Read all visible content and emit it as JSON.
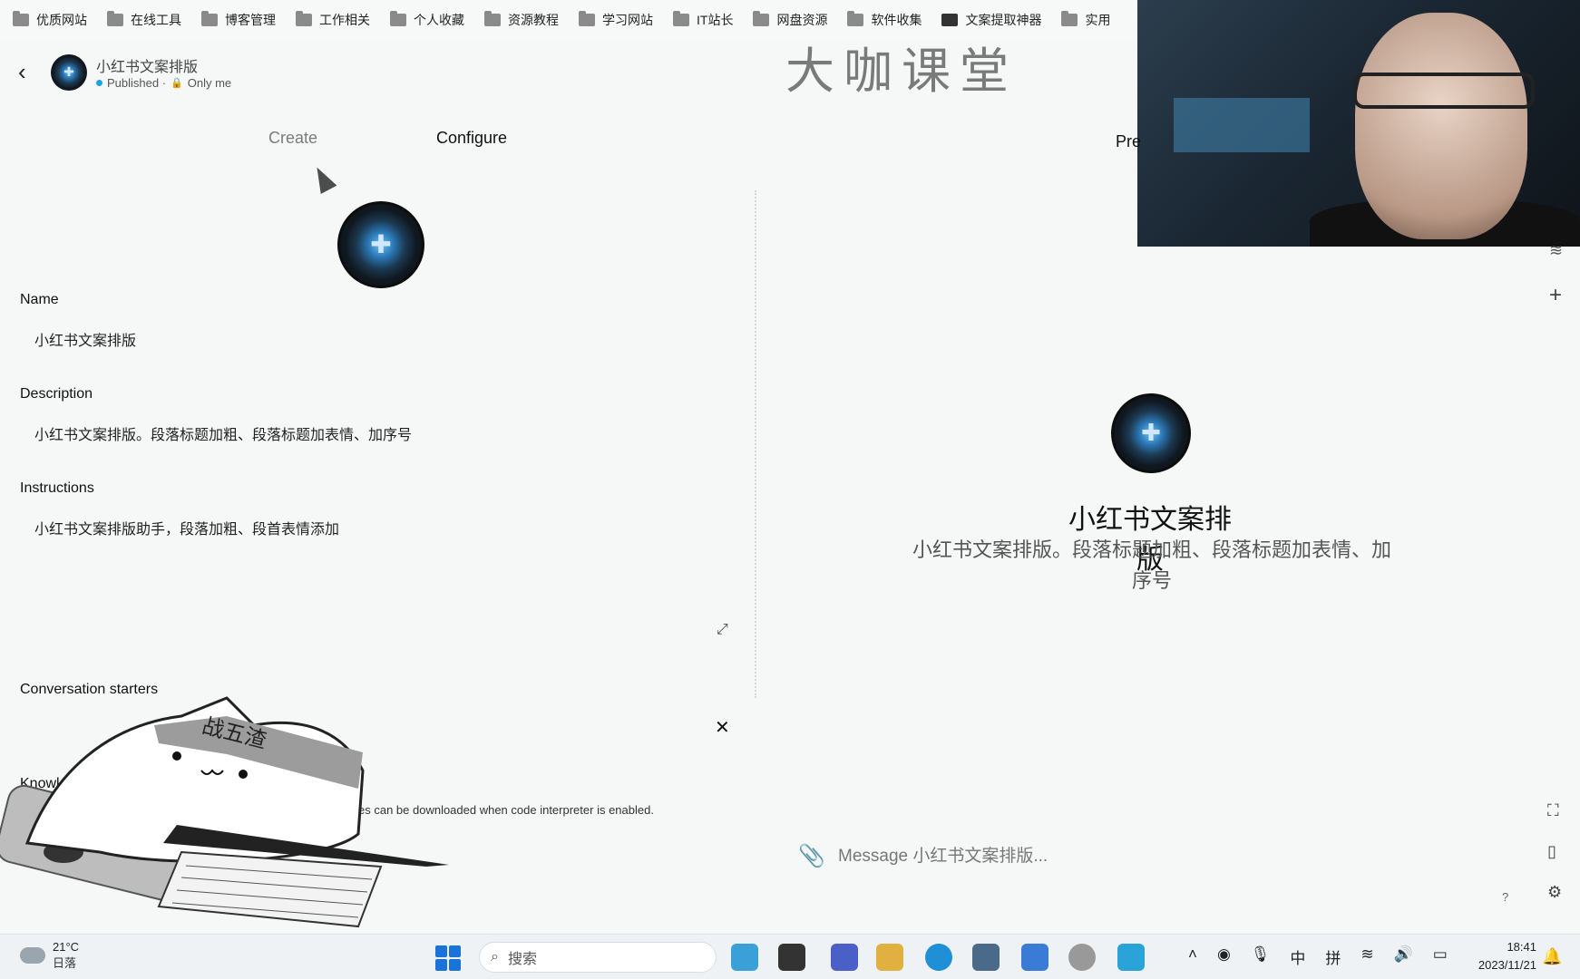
{
  "bookmarks": [
    "优质网站",
    "在线工具",
    "博客管理",
    "工作相关",
    "个人收藏",
    "资源教程",
    "学习网站",
    "IT站长",
    "网盘资源",
    "软件收集",
    "文案提取神器",
    "实用"
  ],
  "brand": "大咖课堂",
  "header": {
    "gpt_name": "小红书文案排版",
    "status": "Published ·",
    "visibility": "Only me"
  },
  "tabs": {
    "create": "Create",
    "configure": "Configure"
  },
  "configure": {
    "name_label": "Name",
    "name_value": "小红书文案排版",
    "description_label": "Description",
    "description_value": "小红书文案排版。段落标题加粗、段落标题加表情、加序号",
    "instructions_label": "Instructions",
    "instructions_value": "小红书文案排版助手，段落加粗、段首表情添加",
    "starters_label": "Conversation starters",
    "knowledge_label": "Knowledge",
    "knowledge_note": "es can be downloaded when code interpreter is enabled."
  },
  "overlay_text": "战五渣",
  "preview": {
    "label": "Pre",
    "title": "小红书文案排版",
    "description": "小红书文案排版。段落标题加粗、段落标题加表情、加序号",
    "message_placeholder": "Message 小红书文案排版...",
    "help": "?"
  },
  "taskbar": {
    "temperature": "21°C",
    "weather": "日落",
    "search_placeholder": "搜索",
    "ime_mode": "中",
    "ime_input": "拼",
    "time": "18:41",
    "date": "2023/11/21"
  }
}
